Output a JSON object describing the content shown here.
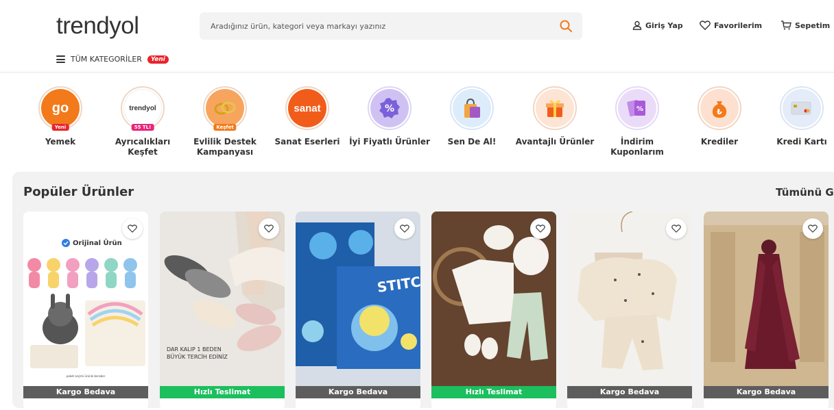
{
  "header": {
    "logo": "trendyol",
    "search_placeholder": "Aradığınız ürün, kategori veya markayı yazınız",
    "login": "Giriş Yap",
    "favorites": "Favorilerim",
    "cart": "Sepetim",
    "all_categories": "TÜM KATEGORİLER",
    "new_badge": "Yeni",
    "accent_color": "#f27a1a"
  },
  "circles": [
    {
      "label": "Yemek",
      "icon_text": "go",
      "badge": "Yeni",
      "color": "#f27a1a"
    },
    {
      "label": "Ayrıcalıkları Keşfet",
      "icon_text": "plus",
      "badge": "55 TL!",
      "color": "#ffffff"
    },
    {
      "label": "Evlilik Destek Kampanyası",
      "icon_text": "rings",
      "badge": "Keşfet",
      "color": "#f28c3c"
    },
    {
      "label": "Sanat Eserleri",
      "icon_text": "sanat",
      "badge": "",
      "color": "#f25c1a"
    },
    {
      "label": "İyi Fiyatlı Ürünler",
      "icon_text": "%",
      "badge": "",
      "color": "#7b61d9"
    },
    {
      "label": "Sen De Al!",
      "icon_text": "bag",
      "badge": "",
      "color": "#dcecfa"
    },
    {
      "label": "Avantajlı Ürünler",
      "icon_text": "gift",
      "badge": "",
      "color": "#fde4d4"
    },
    {
      "label": "İndirim Kuponlarım",
      "icon_text": "coupon",
      "badge": "",
      "color": "#e6d8f7"
    },
    {
      "label": "Krediler",
      "icon_text": "money",
      "badge": "",
      "color": "#fde0cf"
    },
    {
      "label": "Kredi Kartı",
      "icon_text": "card",
      "badge": "",
      "color": "#e3ecf8"
    }
  ],
  "popular": {
    "title": "Popüler Ürünler",
    "see_all": "Tümünü G",
    "products": [
      {
        "ribbon": "Kargo Bedava",
        "ribbon_type": "gray",
        "badge": "Orijinal Ürün",
        "note": ""
      },
      {
        "ribbon": "Hızlı Teslimat",
        "ribbon_type": "green",
        "badge": "",
        "note": "DAR KALIP 1 BEDEN\nBÜYÜK TERCİH EDİNİZ"
      },
      {
        "ribbon": "Kargo Bedava",
        "ribbon_type": "gray",
        "badge": "",
        "note": ""
      },
      {
        "ribbon": "Hızlı Teslimat",
        "ribbon_type": "green",
        "badge": "",
        "note": ""
      },
      {
        "ribbon": "Kargo Bedava",
        "ribbon_type": "gray",
        "badge": "",
        "note": ""
      },
      {
        "ribbon": "Kargo Bedava",
        "ribbon_type": "gray",
        "badge": "",
        "note": ""
      }
    ]
  }
}
